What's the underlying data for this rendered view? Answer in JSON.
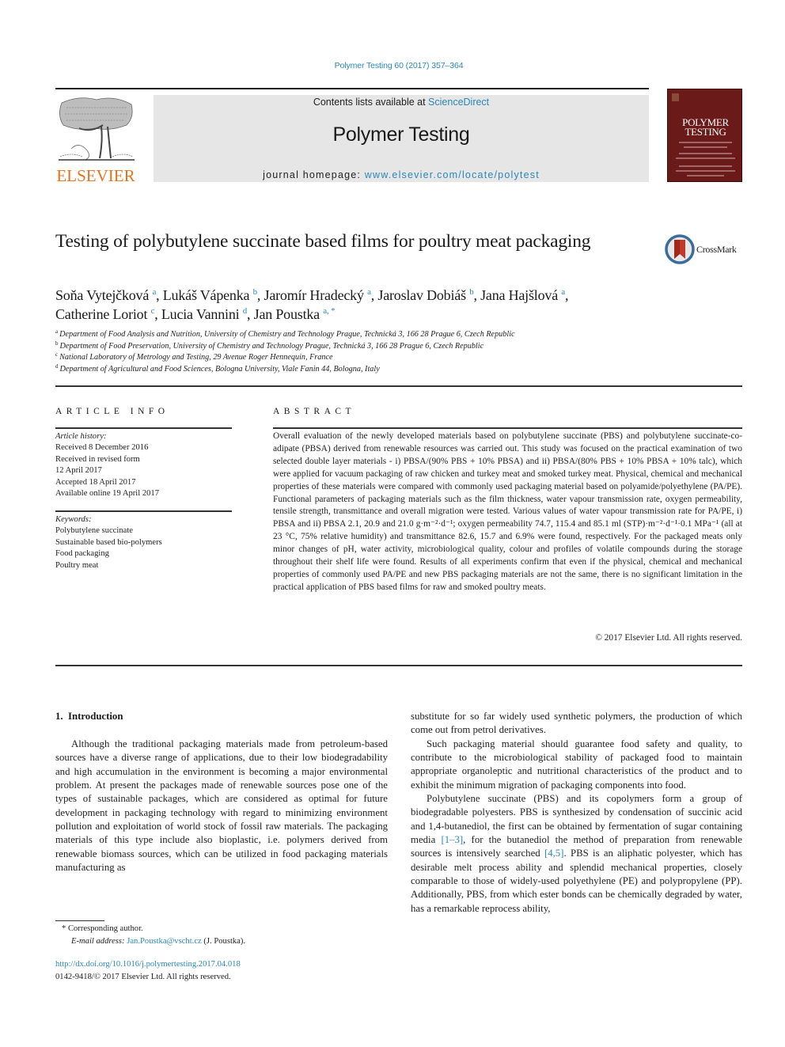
{
  "header": {
    "citation": "Polymer Testing 60 (2017) 357–364",
    "publisher_logo_text": "ELSEVIER",
    "contents_prefix": "Contents lists available at ",
    "contents_link": "ScienceDirect",
    "journal_name": "Polymer Testing",
    "homepage_prefix": "journal homepage: ",
    "homepage_link": "www.elsevier.com/locate/polytest",
    "cover_title_line1": "POLYMER",
    "cover_title_line2": "TESTING",
    "crossmark_label": "CrossMark"
  },
  "article": {
    "title": "Testing of polybutylene succinate based films for poultry meat packaging",
    "authors": [
      {
        "name": "Soňa Vytejčková",
        "sup": "a",
        "sep": ", "
      },
      {
        "name": "Lukáš Vápenka",
        "sup": "b",
        "sep": ", "
      },
      {
        "name": "Jaromír Hradecký",
        "sup": "a",
        "sep": ", "
      },
      {
        "name": "Jaroslav Dobiáš",
        "sup": "b",
        "sep": ", "
      },
      {
        "name": "Jana Hajšlová",
        "sup": "a",
        "sep": ","
      },
      {
        "name": "Catherine Loriot",
        "sup": "c",
        "sep": ", "
      },
      {
        "name": "Lucia Vannini",
        "sup": "d",
        "sep": ", "
      },
      {
        "name": "Jan Poustka",
        "sup": "a, *",
        "sep": ""
      }
    ],
    "affiliations": [
      {
        "sup": "a",
        "text": "Department of Food Analysis and Nutrition, University of Chemistry and Technology Prague, Technická 3, 166 28 Prague 6, Czech Republic"
      },
      {
        "sup": "b",
        "text": "Department of Food Preservation, University of Chemistry and Technology Prague, Technická 3, 166 28 Prague 6, Czech Republic"
      },
      {
        "sup": "c",
        "text": "National Laboratory of Metrology and Testing, 29 Avenue Roger Hennequin, France"
      },
      {
        "sup": "d",
        "text": "Department of Agricultural and Food Sciences, Bologna University, Viale Fanin 44, Bologna, Italy"
      }
    ]
  },
  "article_info": {
    "heading": "ARTICLE INFO",
    "history_label": "Article history:",
    "history": [
      "Received 8 December 2016",
      "Received in revised form",
      "12 April 2017",
      "Accepted 18 April 2017",
      "Available online 19 April 2017"
    ],
    "keywords_label": "Keywords:",
    "keywords": [
      "Polybutylene succinate",
      "Sustainable based bio-polymers",
      "Food packaging",
      "Poultry meat"
    ]
  },
  "abstract": {
    "heading": "ABSTRACT",
    "text": "Overall evaluation of the newly developed materials based on polybutylene succinate (PBS) and poly­butylene succinate-co-adipate (PBSA) derived from renewable resources was carried out. This study was focused on the practical examination of two selected double layer materials - i) PBSA/(90% PBS + 10% PBSA) and ii) PBSA/(80% PBS + 10% PBSA + 10% talc), which were applied for vacuum packaging of raw chicken and turkey meat and smoked turkey meat. Physical, chemical and mechanical properties of these materials were compared with commonly used packaging material based on polyamide/polyethylene (PA/PE). Functional parameters of packaging materials such as the film thickness, water vapour trans­mission rate, oxygen permeability, tensile strength, transmittance and overall migration were tested. Various values of water vapour transmission rate for PA/PE, i) PBSA and ii) PBSA 2.1, 20.9 and 21.0 g·m⁻²·d⁻¹; oxygen permeability 74.7, 115.4 and 85.1 ml (STP)·m⁻²·d⁻¹·0.1 MPa⁻¹ (all at 23 °C, 75% relative humidity) and transmittance 82.6, 15.7 and 6.9% were found, respectively. For the packaged meats only minor changes of pH, water activity, microbiological quality, colour and profiles of volatile compounds during the storage throughout their shelf life were found. Results of all experiments confirm that even if the physical, chemical and mechanical properties of commonly used PA/PE and new PBS packaging materials are not the same, there is no significant limitation in the practical application of PBS based films for raw and smoked poultry meats.",
    "copyright": "© 2017 Elsevier Ltd. All rights reserved."
  },
  "body": {
    "section_heading": "1.  Introduction",
    "left_paragraphs": [
      "Although the traditional packaging materials made from petroleum-based sources have a diverse range of applications, due to their low biodegradability and high accumulation in the envi­ronment is becoming a major environmental problem. At present the packages made of renewable sources pose one of the types of sustainable packages, which are considered as optimal for future development in packaging technology with regard to minimizing environment pollution and exploitation of world stock of fossil raw materials. The packaging materials of this type include also bio­plastic, i.e. polymers derived from renewable biomass sources, which can be utilized in food packaging materials manufacturing as"
    ],
    "right_continuation": "substitute for so far widely used synthetic polymers, the production of which come out from petrol derivatives.",
    "right_para2": "Such packaging material should guarantee food safety and quality, to contribute to the microbiological stability of packaged food to maintain appropriate organoleptic and nutritional charac­teristics of the product and to exhibit the minimum migration of packaging components into food.",
    "right_para3_a": "Polybutylene succinate (PBS) and its copolymers form a group of biodegradable polyesters. PBS is synthesized by condensation of succinic acid and 1,4-butanediol, the first can be obtained by fermentation of sugar containing media ",
    "right_para3_ref1": "[1–3]",
    "right_para3_b": ", for the butanediol the method of preparation from renewable sources is intensively searched ",
    "right_para3_ref2": "[4,5]",
    "right_para3_c": ". PBS is an aliphatic polyester, which has desirable melt process ability and splendid mechanical properties, closely comparable to those of widely-used polyethylene (PE) and poly­propylene (PP). Additionally, PBS, from which ester bonds can be chemically degraded by water, has a remarkable reprocess ability,"
  },
  "footnotes": {
    "corresponding_mark": "*",
    "corresponding_text": " Corresponding author.",
    "email_label": "E-mail address: ",
    "email": "Jan.Poustka@vscht.cz",
    "email_suffix": " (J. Poustka).",
    "doi_link": "http://dx.doi.org/10.1016/j.polymertesting.2017.04.018",
    "issn_line": "0142-9418/© 2017 Elsevier Ltd. All rights reserved."
  },
  "colors": {
    "link": "#2a87b8",
    "elsevier_orange": "#e9711c",
    "banner_gray": "#e6e6e6",
    "cover_red": "#6b1a1a"
  }
}
